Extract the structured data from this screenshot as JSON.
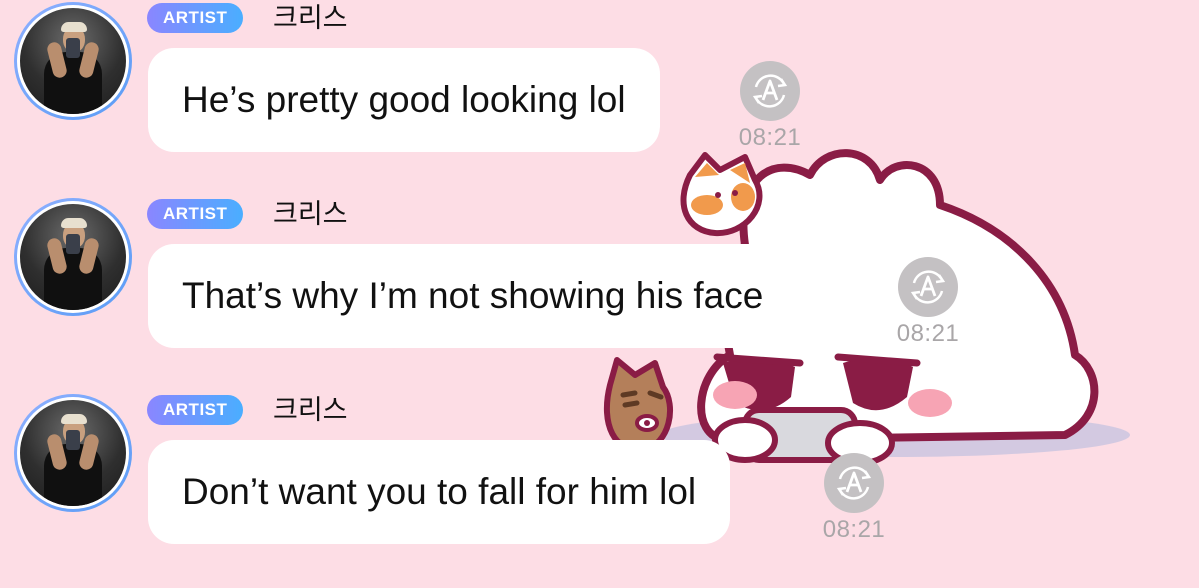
{
  "messages": [
    {
      "badge": "ARTIST",
      "username": "크리스",
      "text": "He’s pretty good looking lol",
      "time": "08:21"
    },
    {
      "badge": "ARTIST",
      "username": "크리스",
      "text": "That’s why I’m not showing his face",
      "time": "08:21"
    },
    {
      "badge": "ARTIST",
      "username": "크리스",
      "text": "Don’t want you to fall for him lol",
      "time": "08:21"
    }
  ],
  "icons": {
    "avatar": "profile-photo",
    "replay": "auto-translate-replay-icon",
    "sticker": "bunny-with-cats-sticker"
  },
  "colors": {
    "background": "#fddde5",
    "bubble": "#ffffff",
    "badge_start": "#8a86ff",
    "badge_end": "#4aaeff",
    "time": "#a9a6a8"
  }
}
